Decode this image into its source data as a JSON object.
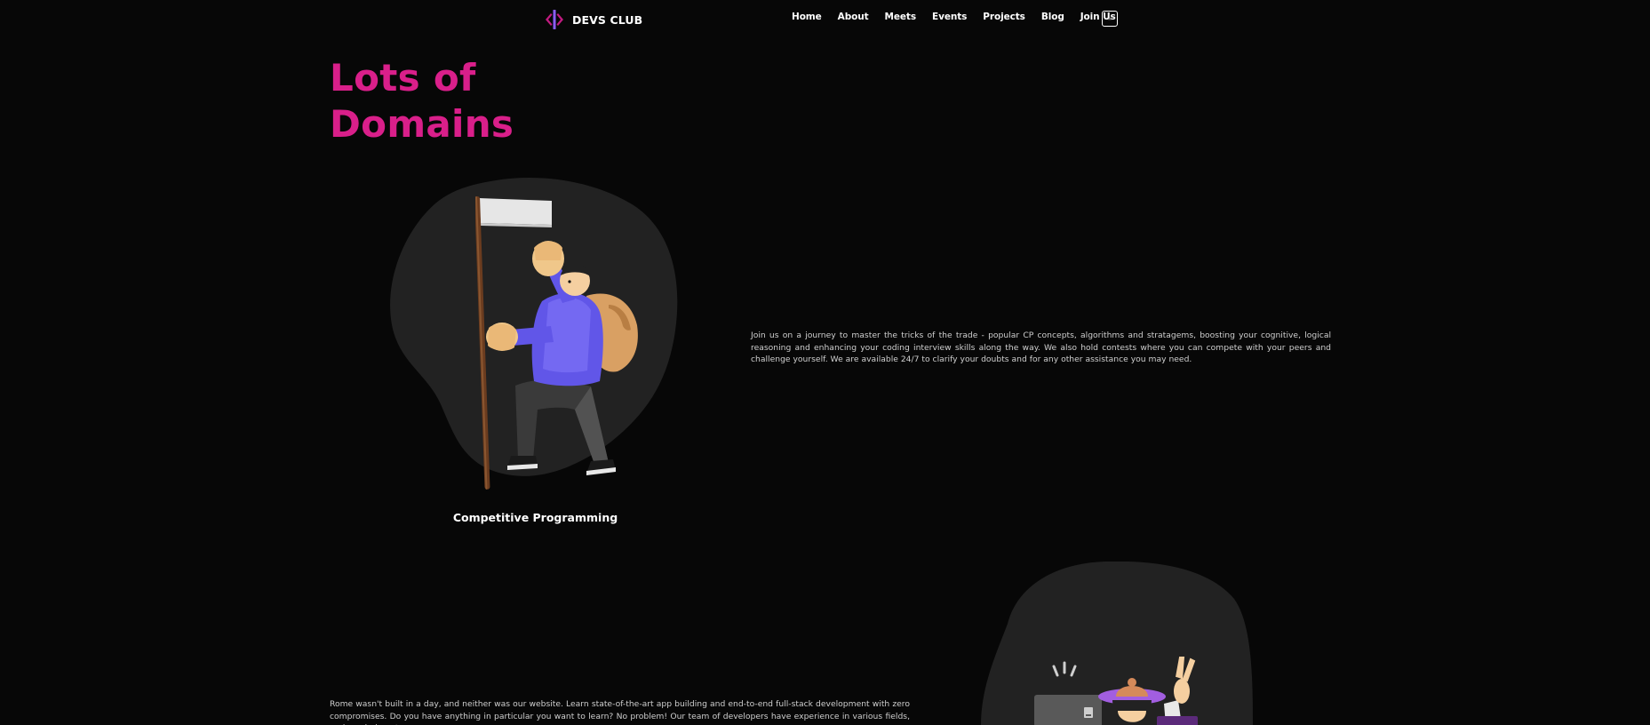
{
  "navbar": {
    "brand_name": "DEVS CLUB",
    "links": [
      {
        "label": "Home"
      },
      {
        "label": "About"
      },
      {
        "label": "Meets"
      },
      {
        "label": "Events"
      },
      {
        "label": "Projects"
      },
      {
        "label": "Blog"
      },
      {
        "label": "Join Us"
      }
    ],
    "theme_toggle_icon": "sun-icon"
  },
  "heading": {
    "line1": "Lots of",
    "line2": "Domains"
  },
  "domains": [
    {
      "title": "Competitive Programming",
      "description": "Join us on a journey to master the tricks of the trade - popular CP concepts, algorithms and stratagems, boosting your cognitive, logical reasoning and enhancing your coding interview skills along the way. We also hold contests where you can compete with your peers and challenge yourself. We are available 24/7 to clarify your doubts and for any other assistance you may need.",
      "illustration_icon": "flag-hiker-icon"
    },
    {
      "description": "Rome wasn't built in a day, and neither was our website. Learn state-of-the-art app building and end-to-end full-stack development with zero compromises. Do you have anything in particular you want to learn? No problem! Our team of developers have experience in various fields, and can help out",
      "illustration_icon": "developer-at-desk-icon"
    }
  ],
  "colors": {
    "accent": "#d91f8a",
    "background": "#070707",
    "blob": "#222222",
    "text": "#cfcfcf"
  }
}
